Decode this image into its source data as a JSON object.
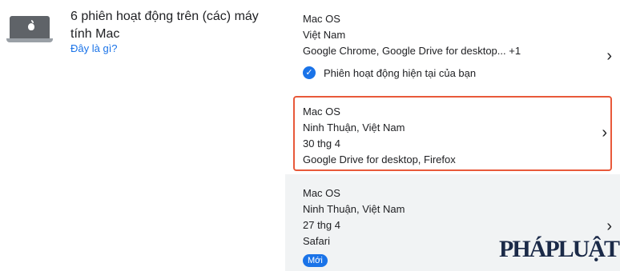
{
  "device": {
    "title": "6 phiên hoạt động trên (các) máy tính Mac",
    "help_link": "Đây là gì?",
    "icon": "laptop-icon"
  },
  "sessions": [
    {
      "os": "Mac OS",
      "location": "Việt Nam",
      "apps": "Google Chrome, Google Drive for desktop... +1",
      "current_label": "Phiên hoạt động hiện tại của bạn"
    },
    {
      "os": "Mac OS",
      "location": "Ninh Thuận, Việt Nam",
      "date": "30 thg 4",
      "apps": "Google Drive for desktop, Firefox",
      "highlight_color": "#e8593a"
    },
    {
      "os": "Mac OS",
      "location": "Ninh Thuận, Việt Nam",
      "date": "27 thg 4",
      "apps": "Safari",
      "badge": "Mới"
    }
  ],
  "watermark": "PHÁPLUẬT",
  "colors": {
    "accent": "#1a73e8",
    "highlight": "#e8593a",
    "selected_bg": "#f1f3f4"
  }
}
